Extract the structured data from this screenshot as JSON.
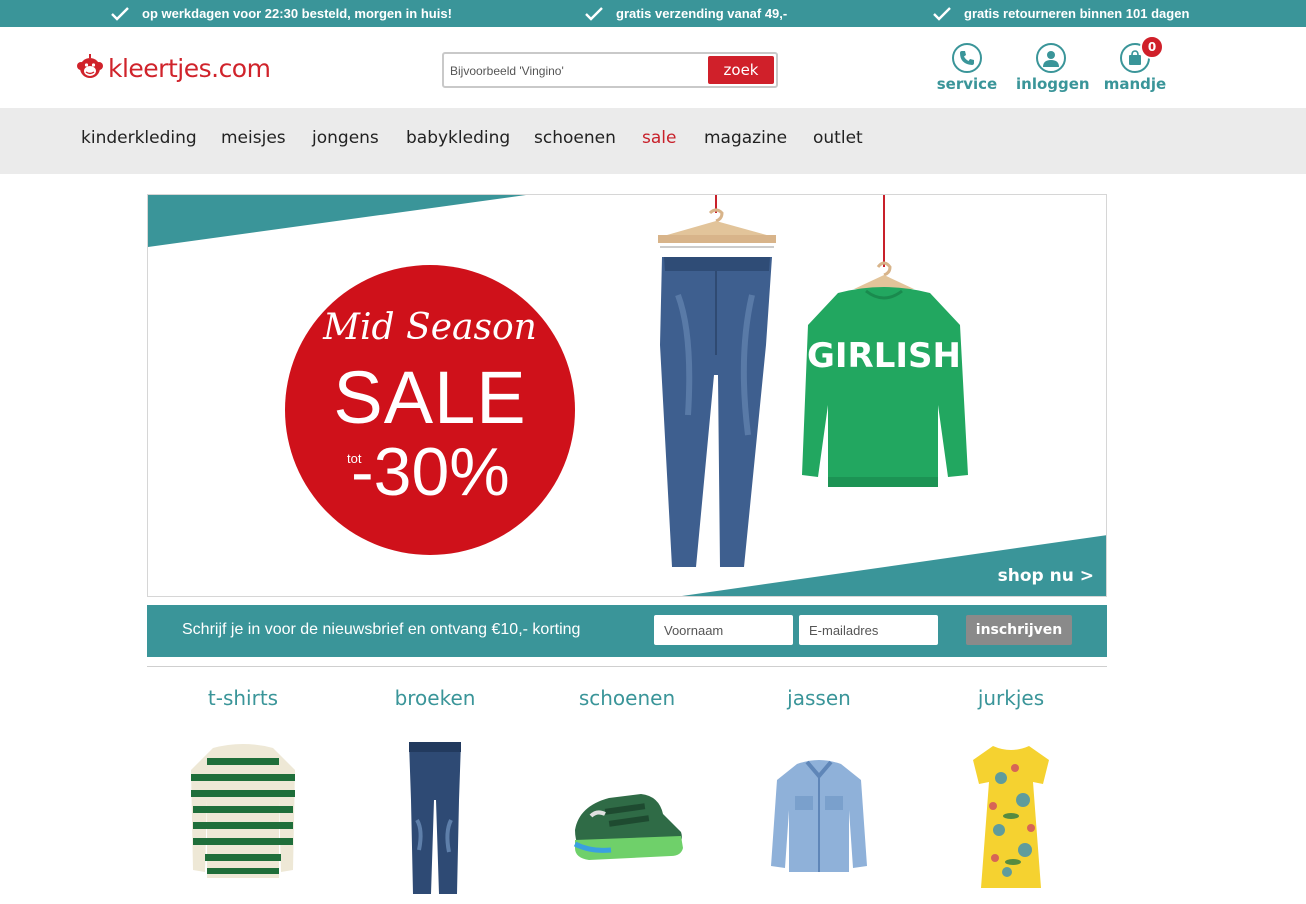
{
  "usp": [
    "op werkdagen voor 22:30 besteld, morgen in huis!",
    "gratis verzending vanaf 49,-",
    "gratis retourneren binnen 101 dagen"
  ],
  "header": {
    "logo_text": "kleertjes.com",
    "search_placeholder": "Bijvoorbeeld 'Vingino'",
    "search_button": "zoek",
    "service_label": "service",
    "login_label": "inloggen",
    "cart_label": "mandje",
    "cart_count": "0"
  },
  "nav": {
    "items": [
      "kinderkleding",
      "meisjes",
      "jongens",
      "babykleding",
      "schoenen",
      "sale",
      "magazine",
      "outlet"
    ]
  },
  "hero": {
    "line1": "Mid Season",
    "line2": "SALE",
    "tot": "tot",
    "discount": "-30%",
    "sweater_text": "GIRLISH",
    "cta": "shop nu >"
  },
  "newsletter": {
    "text": "Schrijf je in voor de nieuwsbrief en ontvang €10,- korting",
    "first_name_placeholder": "Voornaam",
    "email_placeholder": "E-mailadres",
    "button": "inschrijven"
  },
  "categories": [
    "t-shirts",
    "broeken",
    "schoenen",
    "jassen",
    "jurkjes"
  ],
  "colors": {
    "teal": "#3a9599",
    "red": "#d0202a",
    "nav_bg": "#ebebeb"
  }
}
